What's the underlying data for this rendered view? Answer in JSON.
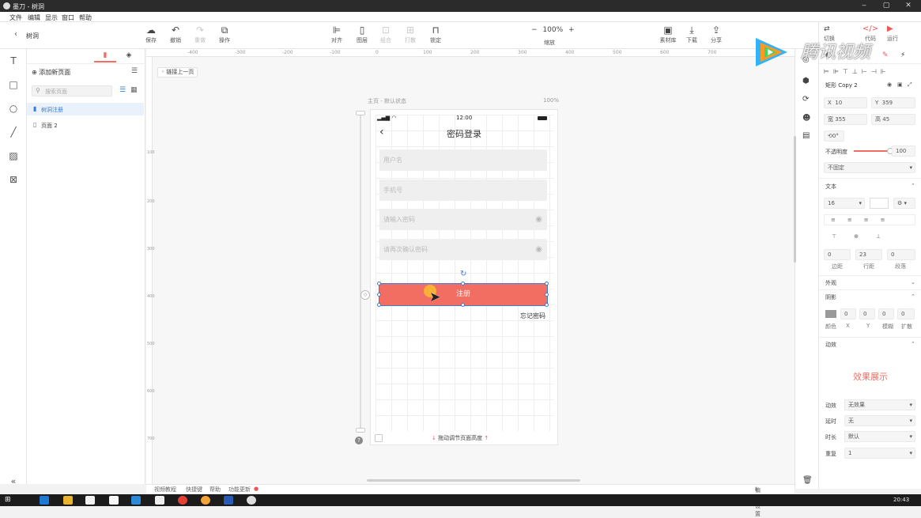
{
  "window": {
    "title": "墨刀 - 树洞",
    "minimize": "‒",
    "maximize": "▢",
    "close": "✕"
  },
  "menu": [
    "文件",
    "编辑",
    "显示",
    "窗口",
    "帮助"
  ],
  "project": {
    "back_label": "树洞"
  },
  "toolbar": {
    "save": "保存",
    "undo": "撤销",
    "redo": "重做",
    "operate": "操作",
    "align": "对齐",
    "layer": "图层",
    "group": "组合",
    "ungroup": "打散",
    "lock": "锁定",
    "zoom": "100%",
    "zoom_label": "缩放",
    "zoom_minus": "−",
    "zoom_plus": "+",
    "assets": "素材库",
    "download": "下载",
    "share": "分享"
  },
  "right_tabs": {
    "a": "切换",
    "b": "代码",
    "c": "运行"
  },
  "pages_panel": {
    "add_page": "添加新页面",
    "search_placeholder": "搜索页面",
    "pages": [
      "树洞注册",
      "页面 2"
    ]
  },
  "canvas": {
    "link_prev": "链接上一页",
    "artboard_label": "主页 - 默认状态",
    "artboard_zoom": "100%",
    "h_ruler": [
      "-400",
      "-300",
      "-200",
      "-100",
      "0",
      "100",
      "200",
      "300",
      "400",
      "500",
      "600",
      "700"
    ],
    "v_ruler": [
      "100",
      "200",
      "300",
      "400",
      "500",
      "600",
      "700"
    ],
    "resize_hint": "拖动调节页面高度"
  },
  "phone": {
    "time": "12:00",
    "title": "密码登录",
    "username_placeholder": "用户名",
    "phone_placeholder": "手机号",
    "password_placeholder": "请输入密码",
    "confirm_placeholder": "请再次确认密码",
    "register_button": "注册",
    "forgot": "忘记密码",
    "accent": "#f26e63"
  },
  "inspector": {
    "name": "矩形 Copy 2",
    "x_label": "X",
    "x": "10",
    "y_label": "Y",
    "y": "359",
    "w_label": "宽",
    "w": "355",
    "h_label": "高",
    "h": "45",
    "rotation": "0°",
    "opacity_label": "不透明度",
    "opacity": "100",
    "fixed": "不固定",
    "text_section": "文本",
    "font_size": "16",
    "spacing": [
      "0",
      "23",
      "0"
    ],
    "spacing_labels": [
      "边距",
      "行距",
      "段落"
    ],
    "appearance": "外观",
    "shadow": "阴影",
    "shadow_values": [
      "0",
      "0",
      "0",
      "0"
    ],
    "shadow_labels": [
      "颜色",
      "X",
      "Y",
      "模糊",
      "扩散"
    ],
    "anim_section": "动效",
    "effect_preview": "效果展示",
    "anim_rows": [
      {
        "label": "动效",
        "value": "无效果"
      },
      {
        "label": "延时",
        "value": "无"
      },
      {
        "label": "时长",
        "value": "默认"
      },
      {
        "label": "重复",
        "value": "1"
      }
    ]
  },
  "statusbar": {
    "tutorial": "视频教程",
    "shortcut": "快捷键",
    "help": "帮助",
    "updates": "功能更新",
    "prefs": "偏好设置"
  },
  "watermark": "腾讯视频",
  "taskbar": {
    "clock": "20:43"
  }
}
